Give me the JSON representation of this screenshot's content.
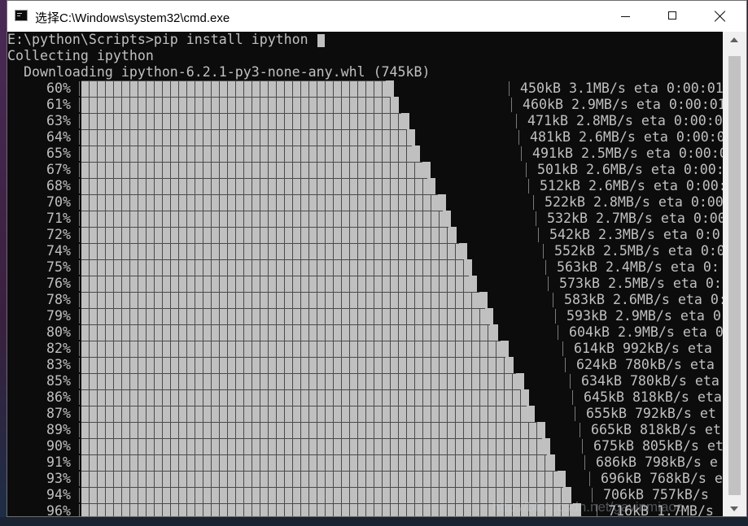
{
  "window": {
    "title": "选择C:\\Windows\\system32\\cmd.exe",
    "icons": [
      "cmd-app-icon",
      "minimize-icon",
      "maximize-icon",
      "close-icon"
    ]
  },
  "console": {
    "prompt": "E:\\python\\Scripts>pip install ipython ",
    "collecting": "Collecting ipython",
    "downloading": "  Downloading ipython-6.2.1-py3-none-any.whl (745kB)",
    "progress": [
      {
        "percent_label": "60%",
        "fraction": 0.6,
        "stats": "450kB 3.1MB/s eta 0:00:01"
      },
      {
        "percent_label": "61%",
        "fraction": 0.61,
        "stats": "460kB 2.9MB/s eta 0:00:01"
      },
      {
        "percent_label": "63%",
        "fraction": 0.63,
        "stats": "471kB 2.8MB/s eta 0:00:0"
      },
      {
        "percent_label": "64%",
        "fraction": 0.64,
        "stats": "481kB 2.6MB/s eta 0:00:0"
      },
      {
        "percent_label": "65%",
        "fraction": 0.65,
        "stats": "491kB 2.5MB/s eta 0:00:0"
      },
      {
        "percent_label": "67%",
        "fraction": 0.67,
        "stats": "501kB 2.6MB/s eta 0:00:"
      },
      {
        "percent_label": "68%",
        "fraction": 0.68,
        "stats": "512kB 2.6MB/s eta 0:00:"
      },
      {
        "percent_label": "70%",
        "fraction": 0.7,
        "stats": "522kB 2.8MB/s eta 0:00"
      },
      {
        "percent_label": "71%",
        "fraction": 0.71,
        "stats": "532kB 2.7MB/s eta 0:00"
      },
      {
        "percent_label": "72%",
        "fraction": 0.72,
        "stats": "542kB 2.3MB/s eta 0:0"
      },
      {
        "percent_label": "74%",
        "fraction": 0.74,
        "stats": "552kB 2.5MB/s eta 0:0"
      },
      {
        "percent_label": "75%",
        "fraction": 0.75,
        "stats": "563kB 2.4MB/s eta 0:"
      },
      {
        "percent_label": "76%",
        "fraction": 0.76,
        "stats": "573kB 2.5MB/s eta 0:"
      },
      {
        "percent_label": "78%",
        "fraction": 0.78,
        "stats": "583kB 2.6MB/s eta 0:"
      },
      {
        "percent_label": "79%",
        "fraction": 0.79,
        "stats": "593kB 2.9MB/s eta 0"
      },
      {
        "percent_label": "80%",
        "fraction": 0.8,
        "stats": "604kB 2.9MB/s eta 0"
      },
      {
        "percent_label": "82%",
        "fraction": 0.82,
        "stats": "614kB 992kB/s eta"
      },
      {
        "percent_label": "83%",
        "fraction": 0.83,
        "stats": "624kB 780kB/s eta"
      },
      {
        "percent_label": "85%",
        "fraction": 0.85,
        "stats": "634kB 780kB/s eta"
      },
      {
        "percent_label": "86%",
        "fraction": 0.86,
        "stats": "645kB 818kB/s eta"
      },
      {
        "percent_label": "87%",
        "fraction": 0.87,
        "stats": "655kB 792kB/s et"
      },
      {
        "percent_label": "89%",
        "fraction": 0.89,
        "stats": "665kB 818kB/s et"
      },
      {
        "percent_label": "90%",
        "fraction": 0.9,
        "stats": "675kB 805kB/s et"
      },
      {
        "percent_label": "91%",
        "fraction": 0.91,
        "stats": "686kB 798kB/s e"
      },
      {
        "percent_label": "93%",
        "fraction": 0.93,
        "stats": "696kB 768kB/s e"
      },
      {
        "percent_label": "94%",
        "fraction": 0.94,
        "stats": "706kB 757kB/s"
      },
      {
        "percent_label": "96%",
        "fraction": 0.96,
        "stats": "716kB 1.7MB/s"
      }
    ]
  },
  "watermark": "http://blog.csdn.net/gavinmiaoc",
  "colors": {
    "console_bg": "#0c0c0c",
    "console_text": "#c0c0c0",
    "titlebar_bg": "#ffffff",
    "scrollbar_bg": "#f0f0f0"
  }
}
